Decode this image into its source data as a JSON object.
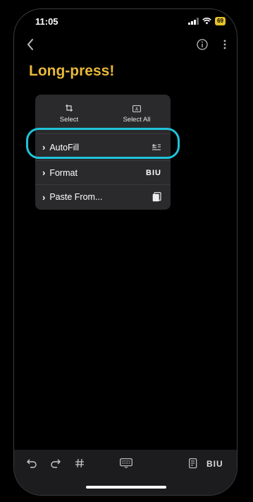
{
  "status_bar": {
    "time": "11:05",
    "battery": "69"
  },
  "nav": {
    "back_icon": "chevron-left-icon",
    "info_icon": "info-icon",
    "more_icon": "ellipsis-vertical-icon"
  },
  "note": {
    "title": "Long-press!"
  },
  "context_menu": {
    "select_label": "Select",
    "select_all_label": "Select All",
    "items": [
      {
        "label": "AutoFill",
        "icon": "autofill-icon"
      },
      {
        "label": "Format",
        "icon": "BIU"
      },
      {
        "label": "Paste From...",
        "icon": "paste-icon"
      }
    ]
  },
  "toolbar": {
    "biu_label": "BIU"
  },
  "colors": {
    "accent_title": "#e8b83a",
    "highlight": "#20c3d8",
    "battery": "#e6c229"
  }
}
